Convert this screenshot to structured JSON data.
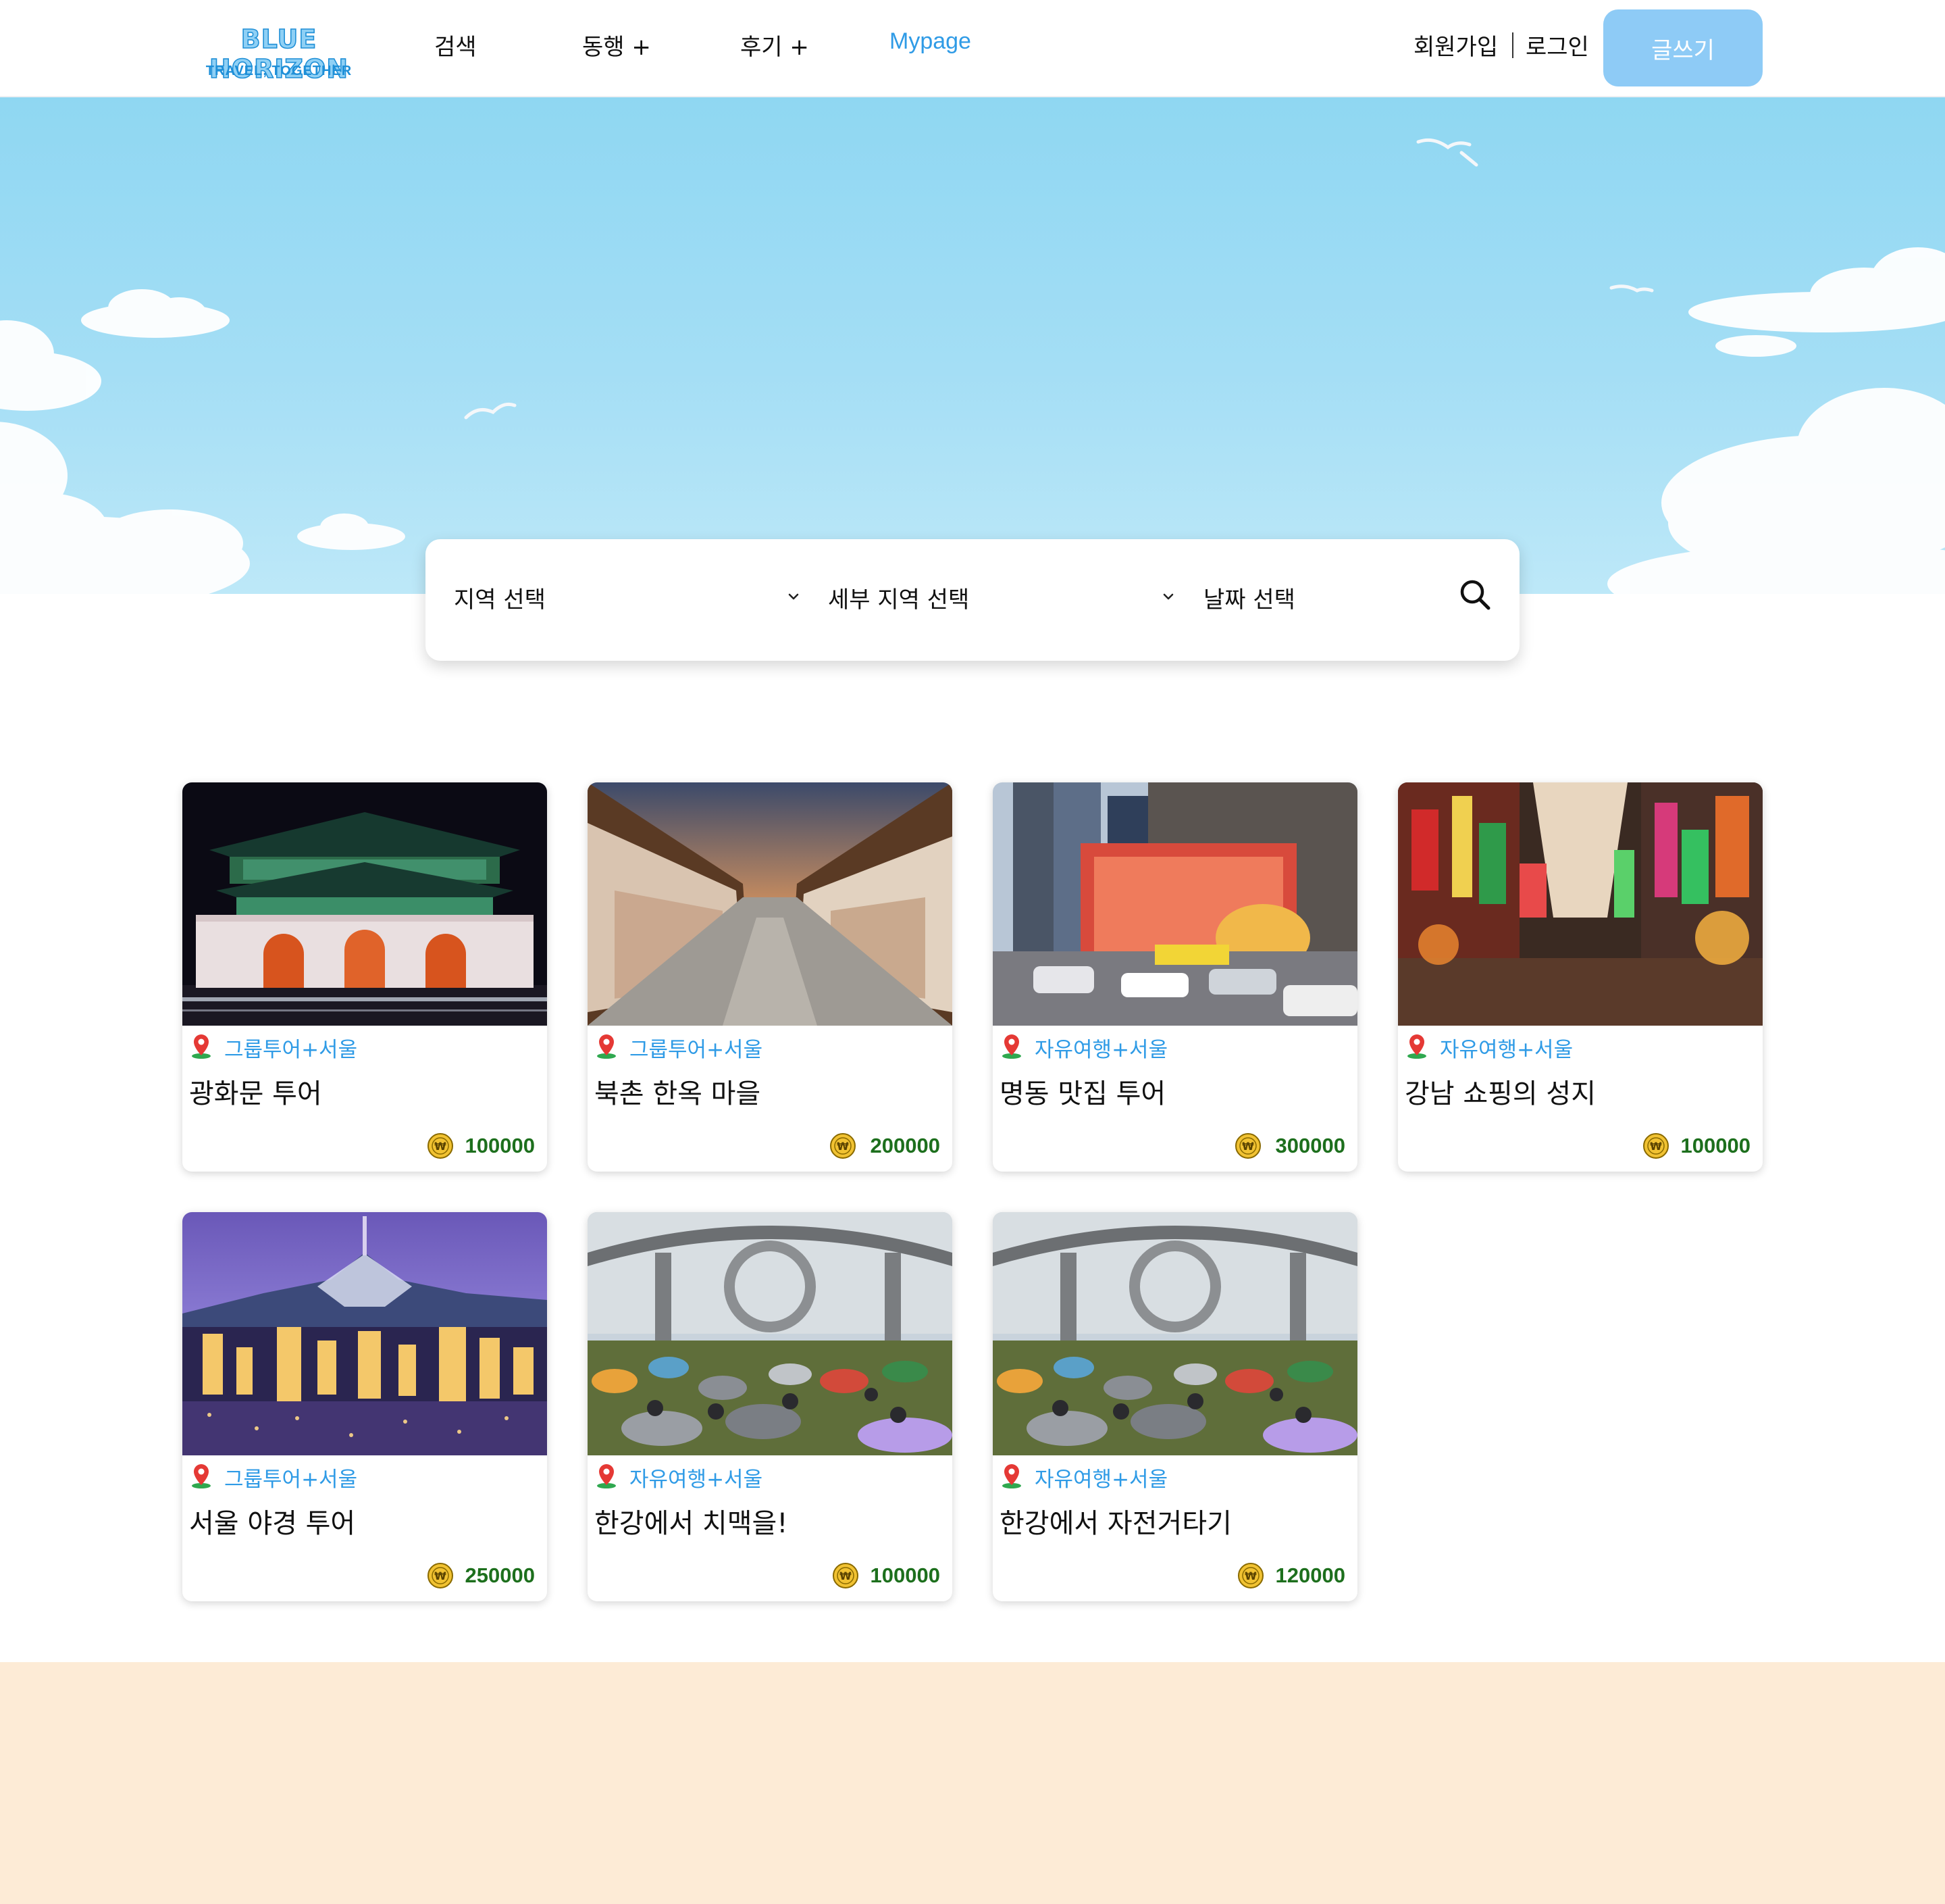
{
  "brand": {
    "name": "BLUE HORIZON",
    "tagline": "TRAVEL, TOGETHER"
  },
  "nav": {
    "items": [
      {
        "label": "검색"
      },
      {
        "label": "동행 +"
      },
      {
        "label": "후기 +"
      },
      {
        "label": "Mypage"
      }
    ]
  },
  "auth": {
    "signup": "회원가입",
    "login": "로그인"
  },
  "write_button": "글쓰기",
  "search": {
    "region": "지역 선택",
    "subregion": "세부 지역 선택",
    "date": "날짜  선택"
  },
  "cards": [
    {
      "category": "그룹투어+서울",
      "title": "광화문 투어",
      "price": "100000"
    },
    {
      "category": "그룹투어+서울",
      "title": "북촌 한옥 마을",
      "price": "200000"
    },
    {
      "category": "자유여행+서울",
      "title": "명동 맛집 투어",
      "price": "300000"
    },
    {
      "category": "자유여행+서울",
      "title": "강남 쇼핑의 성지",
      "price": "100000"
    },
    {
      "category": "그룹투어+서울",
      "title": "서울 야경 투어",
      "price": "250000"
    },
    {
      "category": "자유여행+서울",
      "title": "한강에서 치맥을!",
      "price": "100000"
    },
    {
      "category": "자유여행+서울",
      "title": "한강에서 자전거타기",
      "price": "120000"
    }
  ],
  "colors": {
    "accent": "#2f9be6",
    "button": "#8ecbf6",
    "price": "#1d6f1d",
    "footer": "#fdebd6",
    "sky": "#8fd7f2"
  }
}
